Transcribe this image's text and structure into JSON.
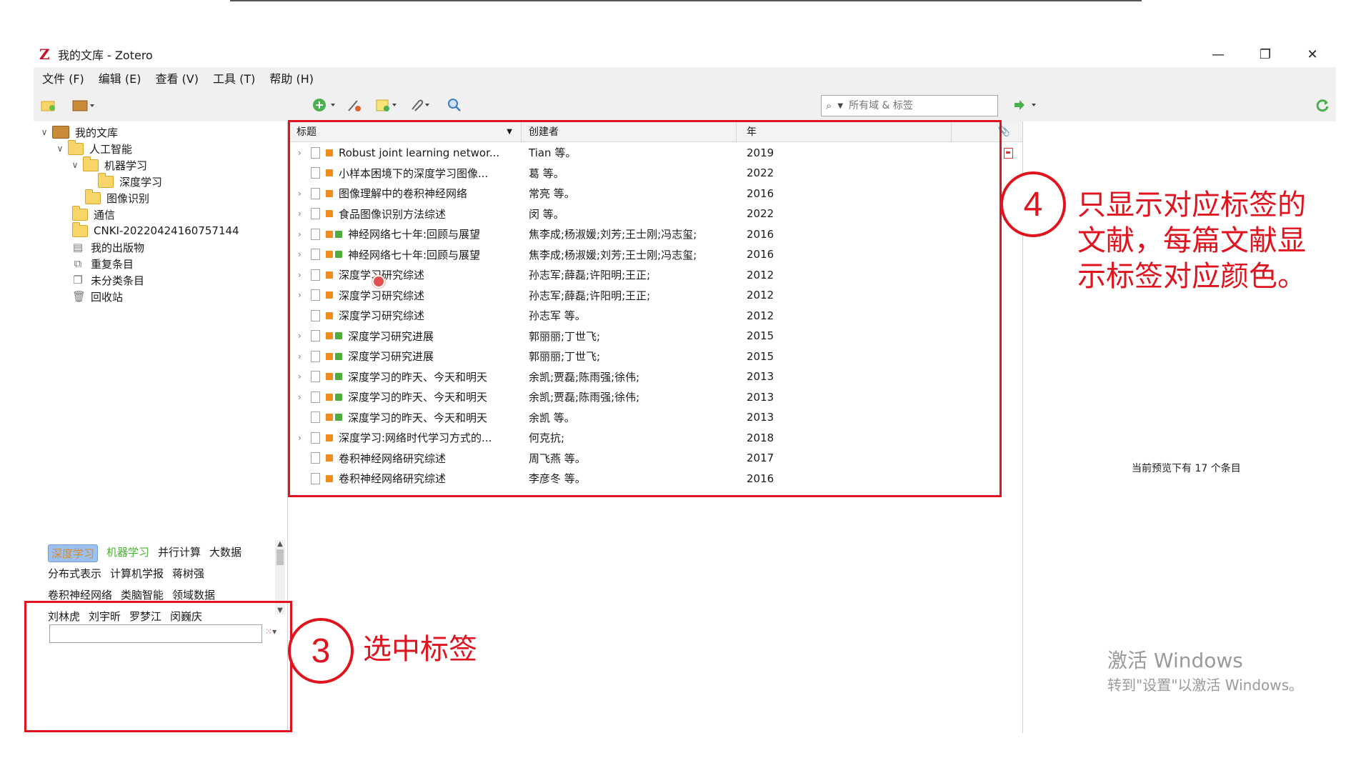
{
  "window": {
    "title": "我的文库 - Zotero",
    "controls": {
      "minimize": "—",
      "restore": "❐",
      "close": "✕"
    }
  },
  "menu": [
    "文件 (F)",
    "编辑 (E)",
    "查看 (V)",
    "工具 (T)",
    "帮助 (H)"
  ],
  "search": {
    "placeholder": "所有域 & 标签"
  },
  "library": {
    "root": "我的文库",
    "collections": [
      {
        "label": "人工智能",
        "level": 1,
        "expanded": true
      },
      {
        "label": "机器学习",
        "level": 2,
        "expanded": true
      },
      {
        "label": "深度学习",
        "level": 3,
        "expanded": false
      },
      {
        "label": "图像识别",
        "level": 2,
        "expanded": false
      },
      {
        "label": "通信",
        "level": 1,
        "expanded": false
      },
      {
        "label": "CNKI-20220424160757144",
        "level": 1,
        "expanded": false
      }
    ],
    "special": [
      {
        "label": "我的出版物",
        "icon": "publications-icon"
      },
      {
        "label": "重复条目",
        "icon": "duplicates-icon"
      },
      {
        "label": "未分类条目",
        "icon": "unfiled-icon"
      },
      {
        "label": "回收站",
        "icon": "trash-icon"
      }
    ]
  },
  "columns": {
    "title": "标题",
    "creator": "创建者",
    "year": "年"
  },
  "items": [
    {
      "title": "Robust joint learning networ...",
      "creator": "Tian 等。",
      "year": "2019",
      "tags": [
        "orange"
      ],
      "pdf": true,
      "expandable": true
    },
    {
      "title": "小样本困境下的深度学习图像...",
      "creator": "葛 等。",
      "year": "2022",
      "tags": [
        "orange"
      ],
      "pdf": false,
      "expandable": false
    },
    {
      "title": "图像理解中的卷积神经网络",
      "creator": "常亮 等。",
      "year": "2016",
      "tags": [
        "orange"
      ],
      "pdf": true,
      "expandable": true
    },
    {
      "title": "食品图像识别方法综述",
      "creator": "闵 等。",
      "year": "2022",
      "tags": [
        "orange"
      ],
      "pdf": true,
      "expandable": true
    },
    {
      "title": "神经网络七十年:回顾与展望",
      "creator": "焦李成;杨淑媛;刘芳;王士刚;冯志玺;",
      "year": "2016",
      "tags": [
        "orange",
        "green"
      ],
      "pdf": false,
      "expandable": true
    },
    {
      "title": "神经网络七十年:回顾与展望",
      "creator": "焦李成;杨淑媛;刘芳;王士刚;冯志玺;",
      "year": "2016",
      "tags": [
        "orange",
        "green"
      ],
      "pdf": false,
      "expandable": true
    },
    {
      "title": "深度学习研究综述",
      "creator": "孙志军;薛磊;许阳明;王正;",
      "year": "2012",
      "tags": [
        "orange"
      ],
      "pdf": false,
      "expandable": true
    },
    {
      "title": "深度学习研究综述",
      "creator": "孙志军;薛磊;许阳明;王正;",
      "year": "2012",
      "tags": [
        "orange"
      ],
      "pdf": false,
      "expandable": true
    },
    {
      "title": "深度学习研究综述",
      "creator": "孙志军 等。",
      "year": "2012",
      "tags": [
        "orange"
      ],
      "pdf": false,
      "expandable": false
    },
    {
      "title": "深度学习研究进展",
      "creator": "郭丽丽;丁世飞;",
      "year": "2015",
      "tags": [
        "orange",
        "green"
      ],
      "pdf": false,
      "expandable": true
    },
    {
      "title": "深度学习研究进展",
      "creator": "郭丽丽;丁世飞;",
      "year": "2015",
      "tags": [
        "orange",
        "green"
      ],
      "pdf": false,
      "expandable": true
    },
    {
      "title": "深度学习的昨天、今天和明天",
      "creator": "余凯;贾磊;陈雨强;徐伟;",
      "year": "2013",
      "tags": [
        "orange",
        "green"
      ],
      "pdf": false,
      "expandable": true
    },
    {
      "title": "深度学习的昨天、今天和明天",
      "creator": "余凯;贾磊;陈雨强;徐伟;",
      "year": "2013",
      "tags": [
        "orange",
        "green"
      ],
      "pdf": false,
      "expandable": true
    },
    {
      "title": "深度学习的昨天、今天和明天",
      "creator": "余凯 等。",
      "year": "2013",
      "tags": [
        "orange",
        "green"
      ],
      "pdf": false,
      "expandable": false
    },
    {
      "title": "深度学习:网络时代学习方式的...",
      "creator": "何克抗;",
      "year": "2018",
      "tags": [
        "orange"
      ],
      "pdf": false,
      "expandable": true
    },
    {
      "title": "卷积神经网络研究综述",
      "creator": "周飞燕 等。",
      "year": "2017",
      "tags": [
        "orange"
      ],
      "pdf": false,
      "expandable": false
    },
    {
      "title": "卷积神经网络研究综述",
      "creator": "李彦冬 等。",
      "year": "2016",
      "tags": [
        "orange"
      ],
      "pdf": false,
      "expandable": false
    }
  ],
  "preview_message": "当前预览下有 17 个条目",
  "tags": {
    "rows": [
      [
        {
          "label": "深度学习",
          "state": "selected"
        },
        {
          "label": "机器学习",
          "state": "colored"
        },
        {
          "label": "并行计算",
          "state": "normal"
        },
        {
          "label": "大数据",
          "state": "normal"
        }
      ],
      [
        {
          "label": "分布式表示",
          "state": "normal"
        },
        {
          "label": "计算机学报",
          "state": "normal"
        },
        {
          "label": "蒋树强",
          "state": "normal"
        }
      ],
      [
        {
          "label": "卷积神经网络",
          "state": "normal"
        },
        {
          "label": "类脑智能",
          "state": "normal"
        },
        {
          "label": "领域数据",
          "state": "normal"
        }
      ],
      [
        {
          "label": "刘林虎",
          "state": "normal"
        },
        {
          "label": "刘宇昕",
          "state": "normal"
        },
        {
          "label": "罗梦江",
          "state": "normal"
        },
        {
          "label": "闵巍庆",
          "state": "normal"
        }
      ]
    ]
  },
  "annotations": {
    "step3": {
      "number": "3",
      "text": "选中标签"
    },
    "step4": {
      "number": "4",
      "text_lines": [
        "只显示对应标签的",
        "文献，每篇文献显",
        "示标签对应颜色。"
      ]
    }
  },
  "watermark": {
    "line1": "激活 Windows",
    "line2": "转到\"设置\"以激活 Windows。"
  },
  "colors": {
    "accent_red": "#e0141e",
    "tag_orange": "#f28a1e",
    "tag_green": "#4fae3a"
  }
}
